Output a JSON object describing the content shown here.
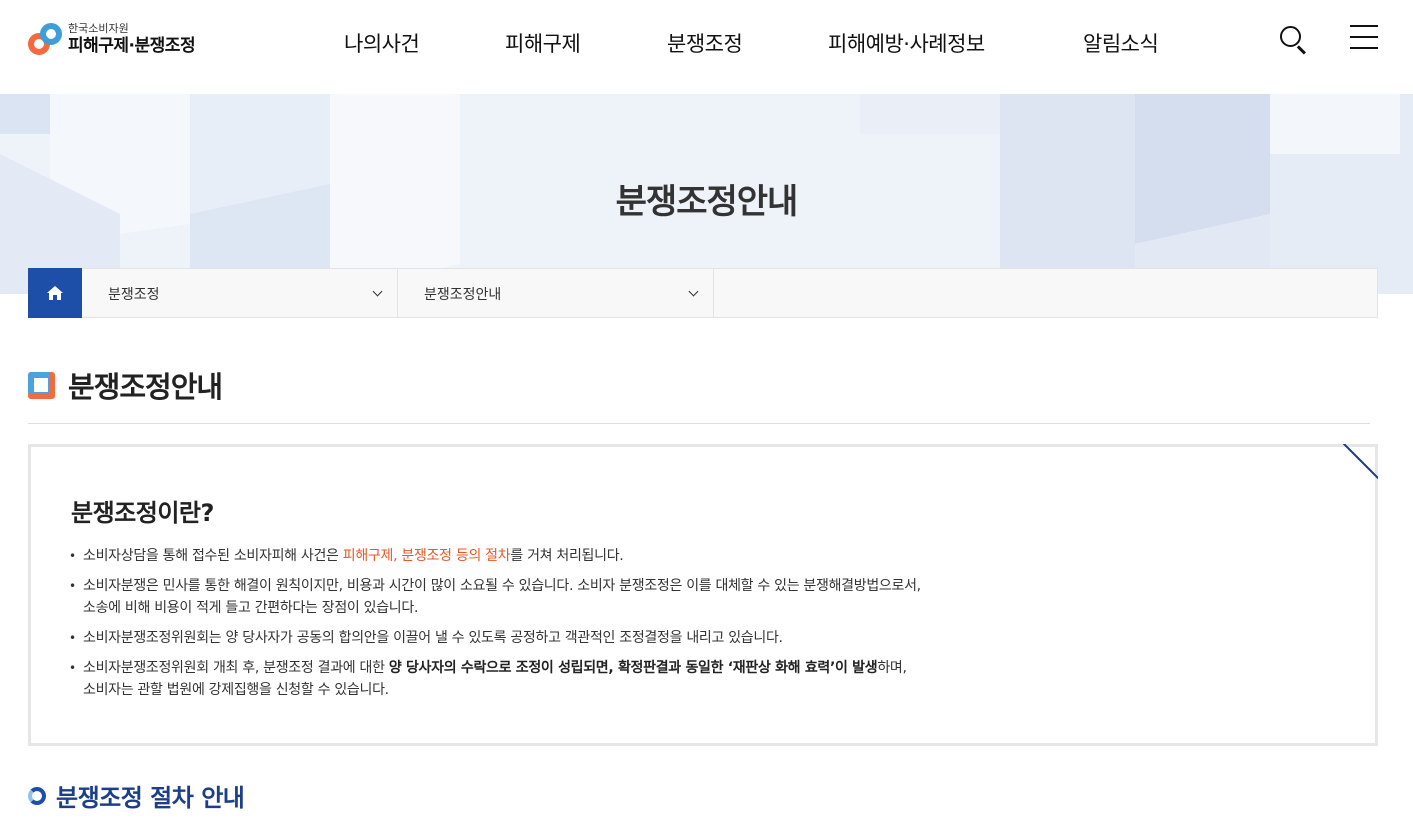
{
  "logo": {
    "org": "한국소비자원",
    "service": "피해구제·분쟁조정"
  },
  "nav": {
    "items": [
      "나의사건",
      "피해구제",
      "분쟁조정",
      "피해예방·사례정보",
      "알림소식"
    ]
  },
  "header": {
    "search_icon": "search-icon",
    "menu_icon": "hamburger-menu-icon"
  },
  "banner": {
    "title": "분쟁조정안내"
  },
  "breadcrumb": {
    "home_icon": "home-icon",
    "level1": "분쟁조정",
    "level2": "분쟁조정안내"
  },
  "page": {
    "title": "분쟁조정안내"
  },
  "info": {
    "title": "분쟁조정이란?",
    "item1_pre": "소비자상담을 통해 접수된 소비자피해 사건은 ",
    "item1_hl": "피해구제, 분쟁조정 등의 절차",
    "item1_post": "를 거쳐 처리됩니다.",
    "item2_line1": "소비자분쟁은 민사를 통한 해결이 원칙이지만, 비용과 시간이 많이 소요될 수 있습니다. 소비자 분쟁조정은 이를 대체할 수 있는 분쟁해결방법으로서,",
    "item2_line2": "소송에 비해 비용이 적게 들고 간편하다는 장점이 있습니다.",
    "item3": "소비자분쟁조정위원회는 양 당사자가 공동의 합의안을 이끌어 낼 수 있도록 공정하고 객관적인 조정결정을 내리고 있습니다.",
    "item4_pre": "소비자분쟁조정위원회 개최 후, 분쟁조정 결과에 대한 ",
    "item4_bold": "양 당사자의 수락으로 조정이 성립되면, 확정판결과 동일한 ‘재판상 화해 효력’이 발생",
    "item4_post": "하며,",
    "item4_line2": "소비자는 관할 법원에 강제집행을 신청할 수 있습니다."
  },
  "subsection": {
    "title": "분쟁조정 절차 안내"
  },
  "colors": {
    "brand_blue": "#1d4fa8",
    "accent_orange": "#e8582a",
    "logo_blue": "#3e9fd8",
    "logo_orange": "#f26a3d"
  }
}
